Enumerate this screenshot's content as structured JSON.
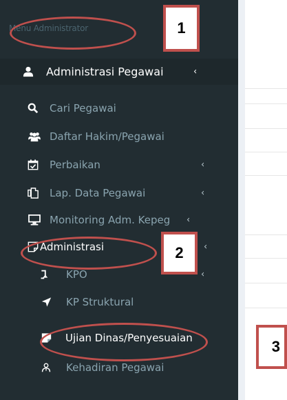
{
  "sidebar": {
    "header": "Menu Administrator",
    "main_item": {
      "label": "Administrasi Pegawai",
      "icon": "user-icon",
      "chevron": "‹"
    },
    "items": [
      {
        "label": "Cari Pegawai",
        "icon": "search-icon"
      },
      {
        "label": "Daftar Hakim/Pegawai",
        "icon": "users-icon"
      },
      {
        "label": "Perbaikan",
        "icon": "calendar-check-icon",
        "chevron": "‹"
      },
      {
        "label": "Lap. Data Pegawai",
        "icon": "copy-icon",
        "chevron": "‹"
      },
      {
        "label": "Monitoring Adm. Kepeg",
        "icon": "desktop-icon",
        "chevron": "‹"
      },
      {
        "label": "Administrasi",
        "icon": "sticky-note-icon",
        "chevron": "‹"
      }
    ],
    "sub_items": [
      {
        "label": "KPO",
        "icon": "level-up-icon",
        "chevron": "‹"
      },
      {
        "label": "KP Struktural",
        "icon": "location-arrow-icon"
      },
      {
        "label": "Ujian Dinas/Penyesuaian",
        "icon": "sticky-note-icon"
      },
      {
        "label": "Kehadiran Pegawai",
        "icon": "user-tie-icon"
      }
    ]
  },
  "annotations": {
    "one": "1",
    "two": "2",
    "three": "3"
  },
  "colors": {
    "sidebar_bg": "#222d32",
    "annotation": "#c0504d"
  }
}
